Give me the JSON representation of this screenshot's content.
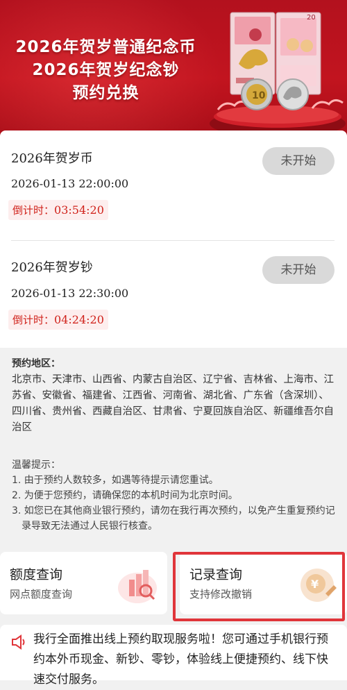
{
  "banner": {
    "line1": "2026年贺岁普通纪念币",
    "line2": "2026年贺岁纪念钞",
    "line3": "预约兑换"
  },
  "slots": [
    {
      "title": "2026年贺岁币",
      "time": "2026-01-13 22:00:00",
      "countdown_label": "倒计时：",
      "countdown": "03:54:20",
      "status": "未开始"
    },
    {
      "title": "2026年贺岁钞",
      "time": "2026-01-13 22:30:00",
      "countdown_label": "倒计时：",
      "countdown": "04:24:20",
      "status": "未开始"
    }
  ],
  "region": {
    "label": "预约地区：",
    "text": "北京市、天津市、山西省、内蒙古自治区、辽宁省、吉林省、上海市、江苏省、安徽省、福建省、江西省、河南省、湖北省、广东省（含深圳）、四川省、贵州省、西藏自治区、甘肃省、宁夏回族自治区、新疆维吾尔自治区"
  },
  "tips": {
    "head": "温馨提示：",
    "items": [
      "1. 由于预约人数较多，如遇等待提示请您重试。",
      "2. 为便于您预约，请确保您的本机时间为北京时间。",
      "3. 如您已在其他商业银行预约，请勿在我行再次预约，以免产生重复预约记录导致无法通过人民银行核查。"
    ]
  },
  "quota": {
    "title": "额度查询",
    "subtitle": "网点额度查询"
  },
  "records": {
    "title": "记录查询",
    "subtitle": "支持修改撤销"
  },
  "notice": {
    "text": "我行全面推出线上预约取现服务啦！您可通过手机银行预约本外币现金、新钞、零钞，体验线上便捷预约、线下快速交付服务。"
  },
  "colors": {
    "brand_red": "#c2141f",
    "countdown_red": "#d0221b",
    "highlight_red": "#e0353a"
  },
  "icons": [
    "banknote-illustration",
    "coin-illustration",
    "quota-chart-icon",
    "yuan-record-icon",
    "speaker-icon"
  ]
}
